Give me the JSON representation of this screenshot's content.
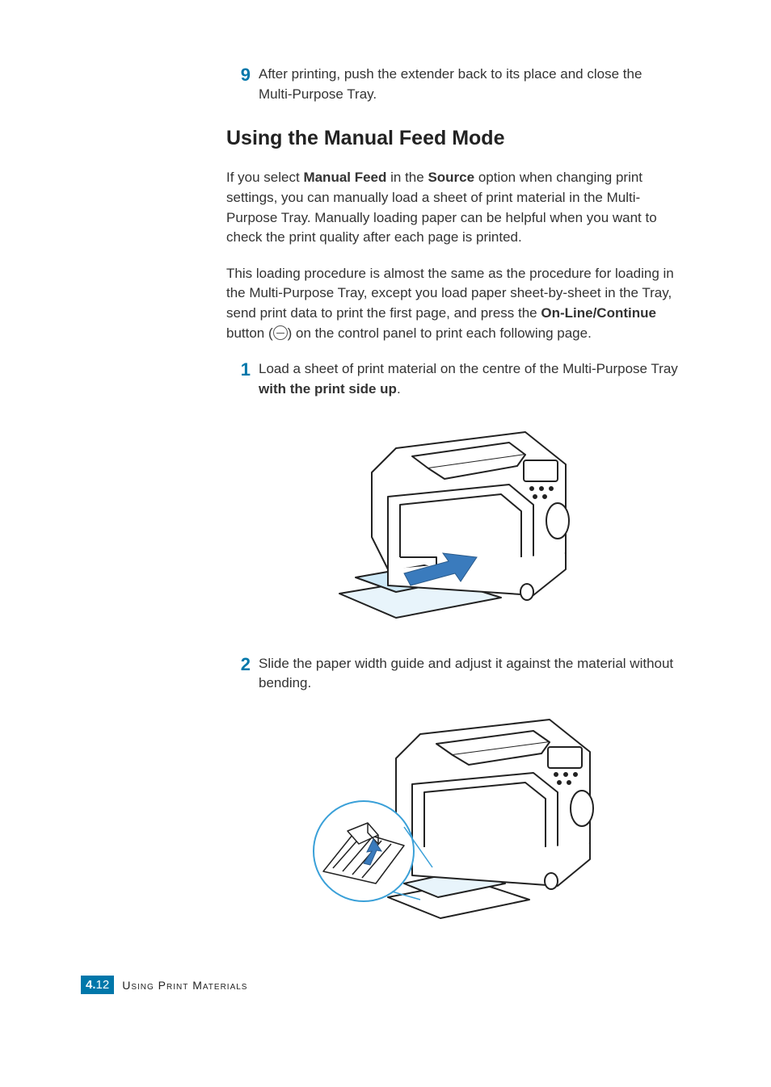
{
  "step9": {
    "num": "9",
    "text_before": "After printing, push the extender back to its place and close the Multi-Purpose Tray."
  },
  "section_heading": "Using the Manual Feed Mode",
  "para1": {
    "prefix": "If you select ",
    "b1": "Manual Feed",
    "mid1": " in the ",
    "b2": "Source",
    "suffix": " option when changing print settings, you can manually load a sheet of print material in the Multi-Purpose Tray. Manually loading paper can be helpful when you want to check the print quality after each page is printed."
  },
  "para2": {
    "prefix": "This loading procedure is almost the same as the procedure for loading in the Multi-Purpose Tray, except you load paper sheet-by-sheet in the Tray, send print data to print the first page, and press the ",
    "b1": "On-Line/Continue",
    "mid1": " button (",
    "mid2": ") on the control panel to print each following page."
  },
  "step1": {
    "num": "1",
    "prefix": "Load a sheet of print material on the centre of the Multi-Purpose Tray ",
    "b1": "with the print side up",
    "suffix": "."
  },
  "step2": {
    "num": "2",
    "text": "Slide the paper width guide and adjust it against the material without bending."
  },
  "footer": {
    "chapter": "4.",
    "page": "12",
    "title": "Using Print Materials"
  }
}
